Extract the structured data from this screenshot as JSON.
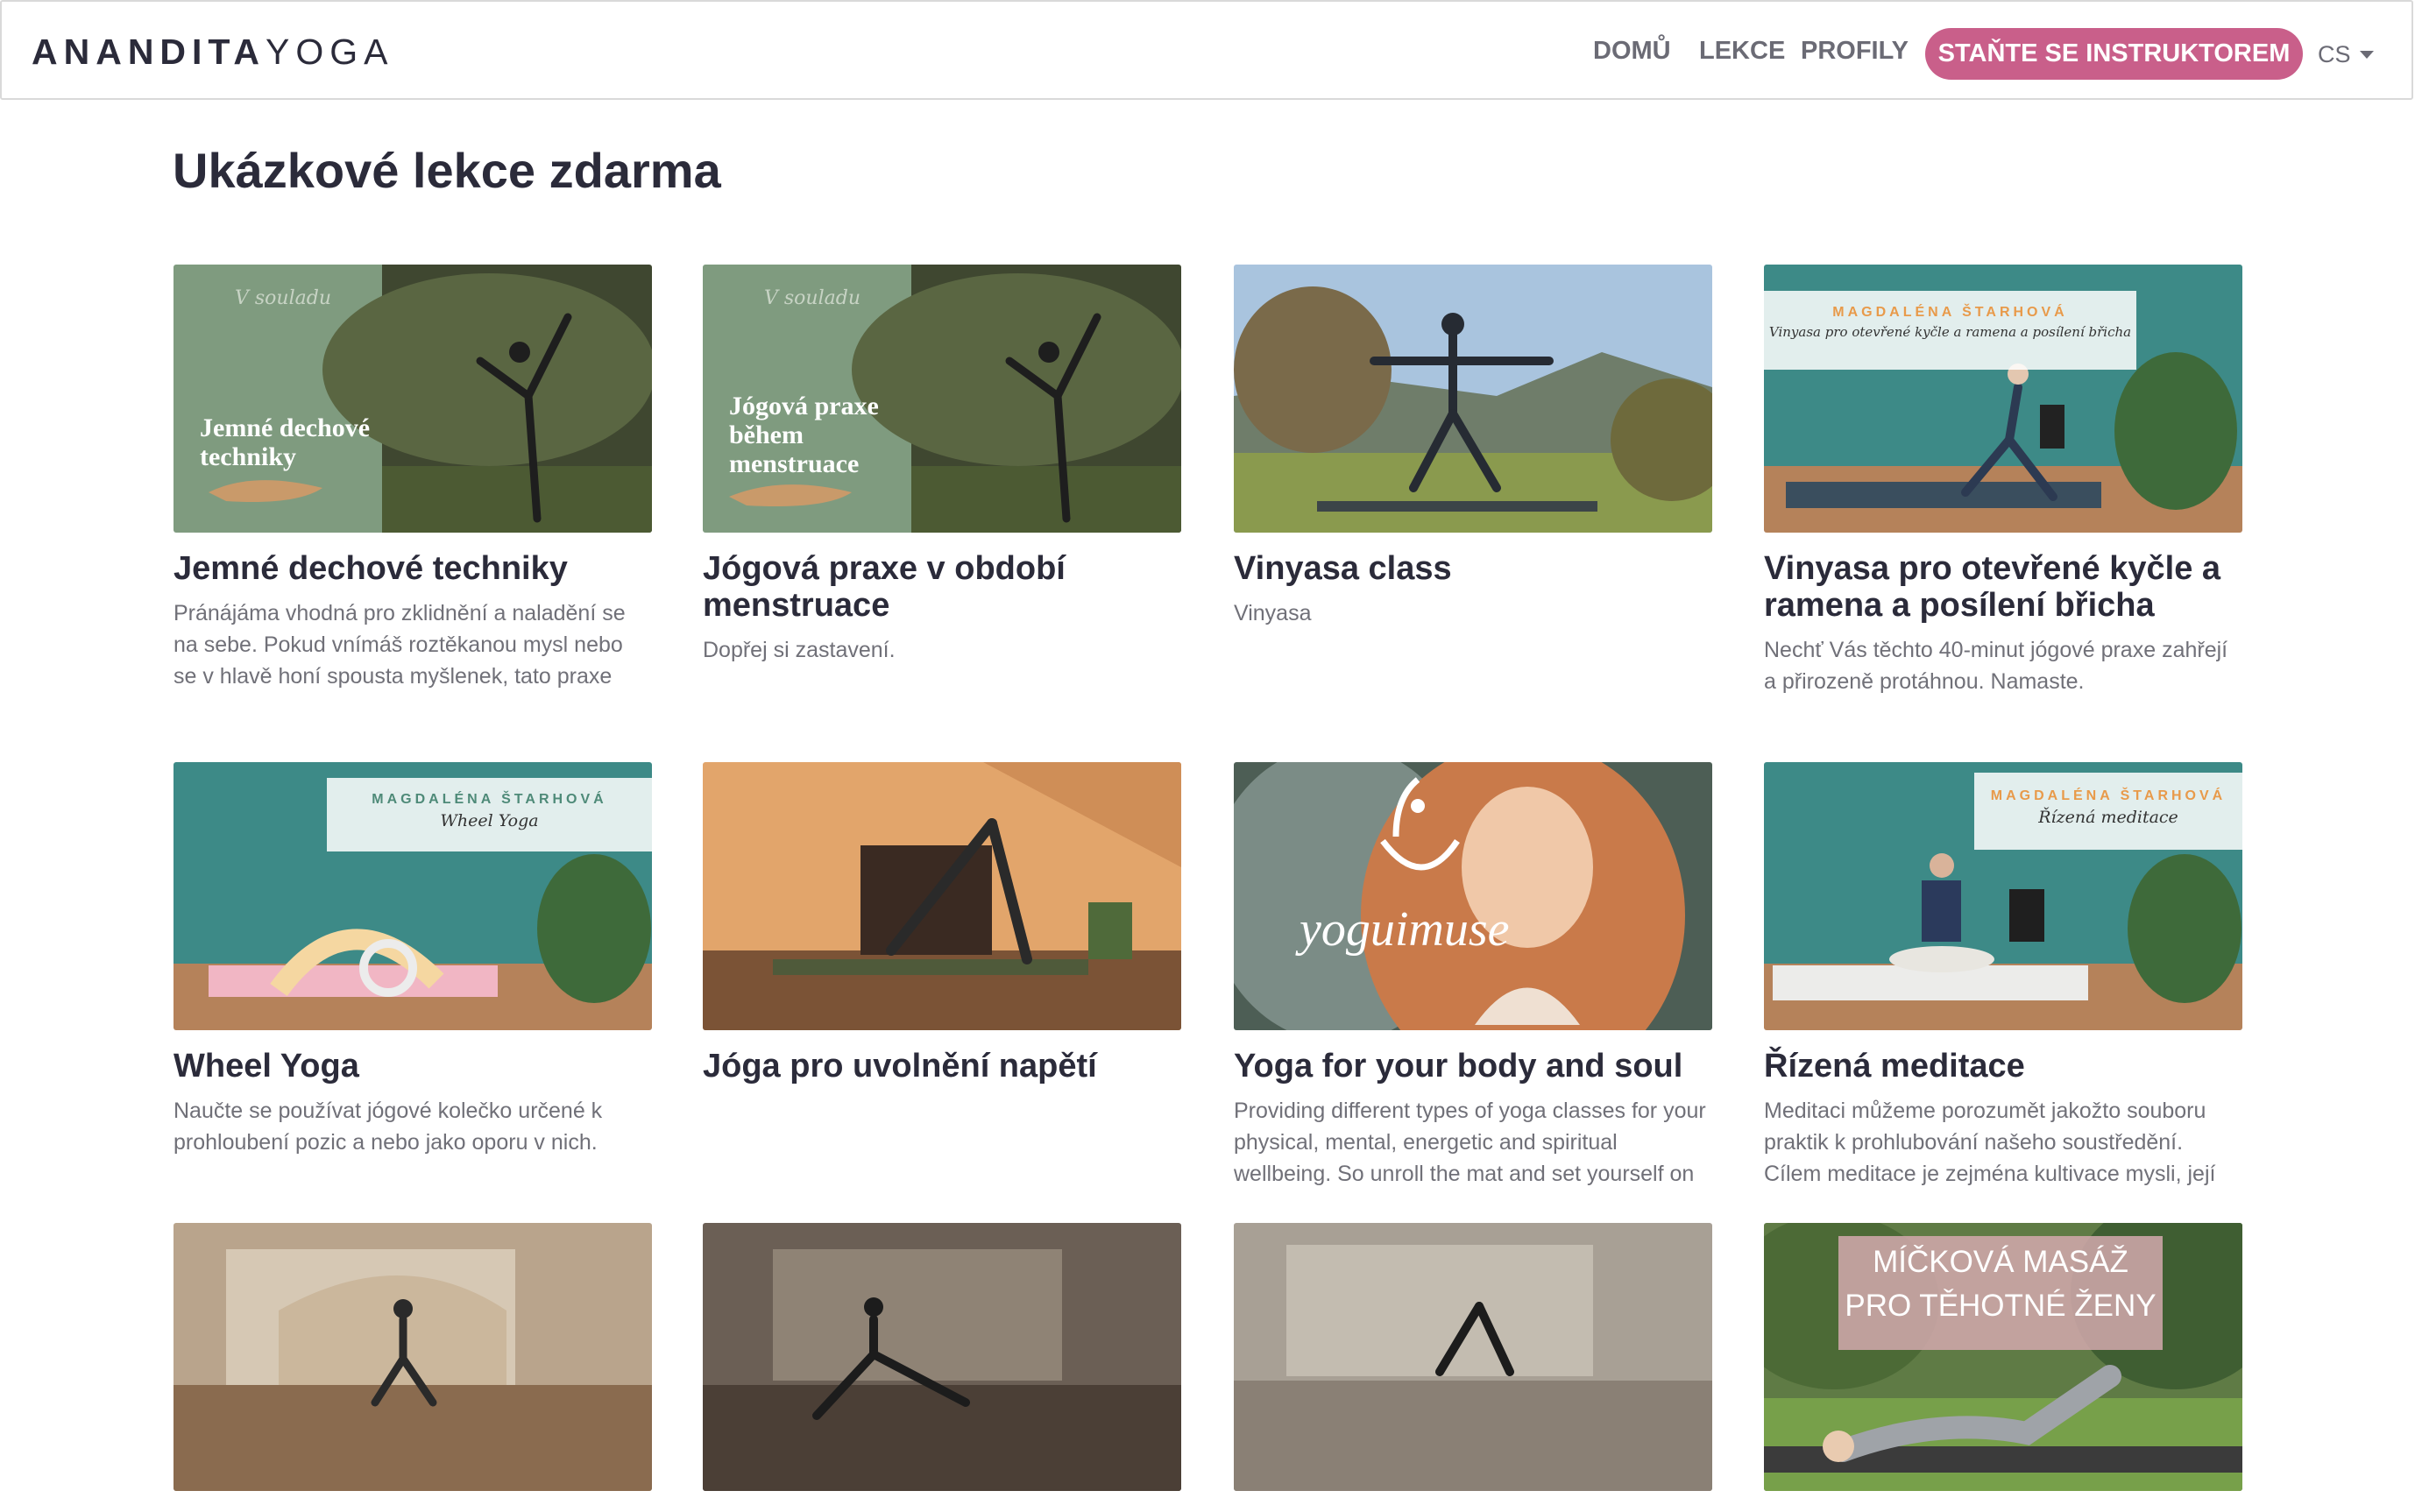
{
  "brand": {
    "bold": "ANANDITA",
    "light": "YOGA"
  },
  "nav": {
    "home": "DOMŮ",
    "lessons": "LEKCE",
    "profiles": "PROFILY",
    "cta": "STAŇTE SE INSTRUKTOREM",
    "lang": "CS"
  },
  "page_title": "Ukázkové lekce zdarma",
  "cards": [
    {
      "title": "Jemné dechové techniky",
      "desc": "Pránájáma vhodná pro zklidnění a naladění se na sebe. Pokud vnímáš roztěkanou mysl nebo se v hlavě honí spousta myšlenek, tato praxe",
      "overlay": "Jemné dechové techniky"
    },
    {
      "title": "Jógová praxe v období menstruace",
      "desc": "Dopřej si zastavení.",
      "overlay": "Jógová praxe během menstruace"
    },
    {
      "title": "Vinyasa class",
      "desc": "Vinyasa"
    },
    {
      "title": "Vinyasa pro otevřené kyčle a ramena a posílení břicha",
      "desc": "Nechť Vás těchto 40-minut jógové praxe zahřejí a přirozeně protáhnou. Namaste.",
      "banner_who": "MAGDALÉNA ŠTARHOVÁ",
      "banner_what": "Vinyasa pro otevřené kyčle a ramena a posílení břicha"
    },
    {
      "title": "Wheel Yoga",
      "desc": "Naučte se používat jógové kolečko určené k prohloubení pozic a nebo jako oporu v nich.",
      "banner_who": "MAGDALÉNA ŠTARHOVÁ",
      "banner_what": "Wheel Yoga"
    },
    {
      "title": "Jóga pro uvolnění napětí",
      "desc": ""
    },
    {
      "title": "Yoga for your body and soul",
      "desc": "Providing different types of yoga classes for your physical, mental, energetic and spiritual wellbeing. So unroll the mat and set yourself on",
      "logo": "yoguimuse"
    },
    {
      "title": "Řízená meditace",
      "desc": "Meditaci můžeme porozumět jakožto souboru praktik k prohlubování našeho soustředění. Cílem meditace je zejména kultivace mysli, její",
      "banner_who": "MAGDALÉNA ŠTARHOVÁ",
      "banner_what": "Řízená meditace"
    },
    {
      "title": "",
      "desc": ""
    },
    {
      "title": "",
      "desc": ""
    },
    {
      "title": "",
      "desc": ""
    },
    {
      "title": "",
      "desc": "",
      "overlay": "MÍČKOVÁ MASÁŽ PRO TĚHOTNÉ ŽENY"
    }
  ]
}
